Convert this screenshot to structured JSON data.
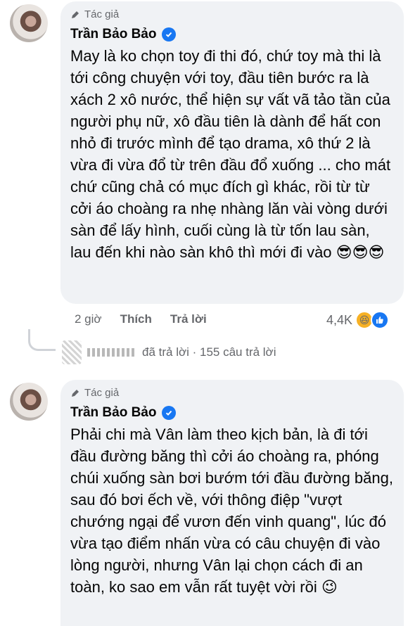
{
  "comment1": {
    "author_badge": "Tác giả",
    "author_name": "Trần Bảo Bảo",
    "text": "May là ko chọn toy đi thi đó, chứ toy mà thi là tới công chuyện với toy, đầu tiên bước ra là xách 2 xô nước, thể hiện sự vất vã tảo tần của người phụ nữ, xô đầu tiên là dành để hất con nhỏ đi trước mình để tạo drama, xô thứ 2 là vừa đi vừa đổ từ trên đầu đổ xuống ... cho mát chứ cũng chả có mục đích gì khác, rồi từ từ cởi áo choàng ra nhẹ nhàng lăn vài vòng dưới sàn để lấy hình, cuối cùng là từ tốn lau sàn, lau đến khi nào sàn khô thì mới đi vào",
    "text_emojis": "😎😎😎",
    "time": "2 giờ",
    "like_label": "Thích",
    "reply_label": "Trả lời",
    "reaction_count": "4,4K",
    "reaction_icons": [
      "haha-reaction-icon",
      "like-reaction-icon"
    ]
  },
  "replies": {
    "text": "đã trả lời · 155 câu trả lời"
  },
  "comment2": {
    "author_badge": "Tác giả",
    "author_name": "Trần Bảo Bảo",
    "text": "Phải chi mà Vân làm theo kịch bản, là đi tới đầu đường băng thì cởi áo choàng ra, phóng chúi xuống sàn bơi bướm tới đầu đường băng, sau đó bơi ếch về, với thông điệp \"vượt chướng ngại để vươn đến vinh quang\", lúc đó vừa tạo điểm nhấn vừa có câu chuyện đi vào lòng người, nhưng Vân lại chọn cách đi an toàn, ko sao em vẫn rất tuyệt vời rồi",
    "text_emoji": "😉"
  },
  "colors": {
    "bubble": "#f0f2f5",
    "verified": "#1877f2",
    "meta": "#65676b",
    "text": "#050505"
  }
}
